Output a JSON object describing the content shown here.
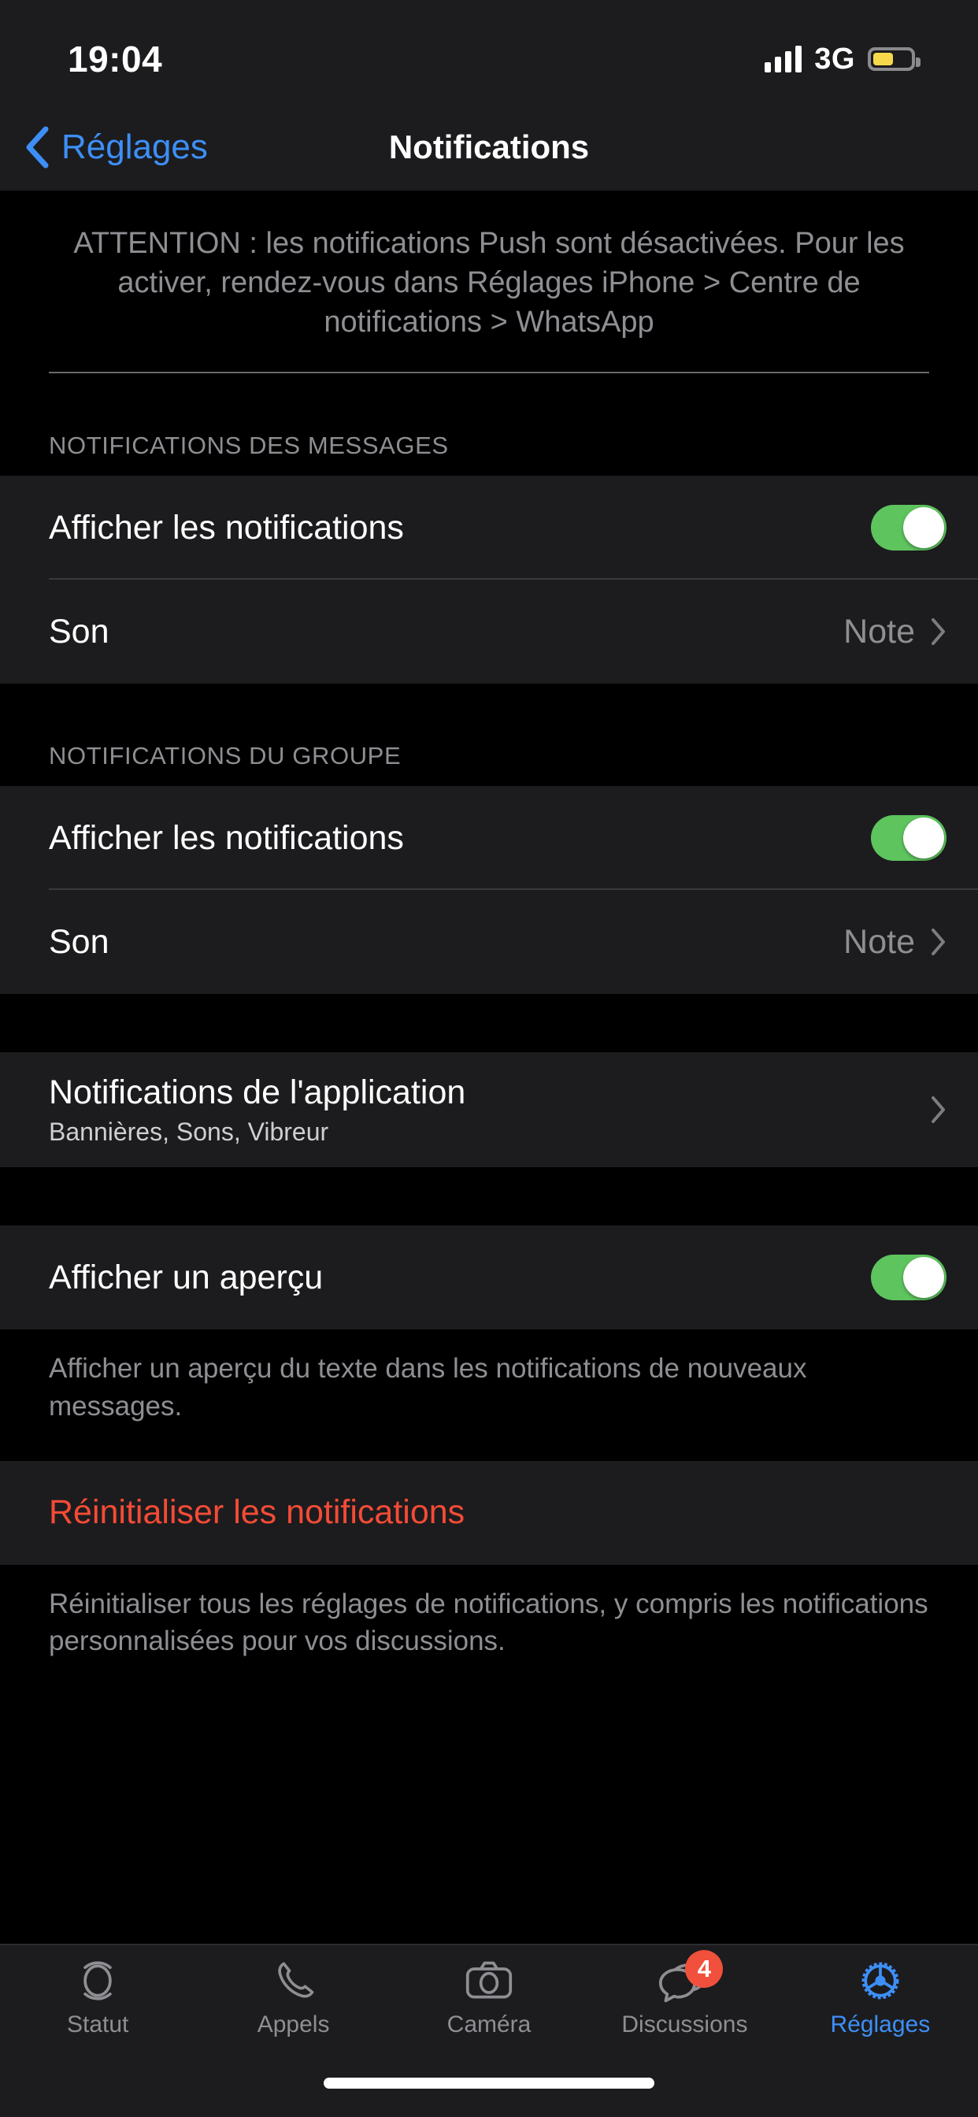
{
  "status_bar": {
    "time": "19:04",
    "network_type": "3G",
    "signal_icon": "cellular-signal-icon",
    "battery_icon": "battery-low-power-icon",
    "battery_color": "#f5d githubusercontent",
    "battery_fill_color": "#f7d84b",
    "battery_level_percent": 55
  },
  "nav_bar": {
    "back_icon": "chevron-left-icon",
    "back_label": "Réglages",
    "title": "Notifications",
    "accent_color": "#3d8ff7"
  },
  "warning": {
    "text": "ATTENTION : les notifications Push sont désactivées. Pour les activer, rendez-vous dans Réglages iPhone > Centre de notifications > WhatsApp"
  },
  "sections": {
    "messages": {
      "header": "NOTIFICATIONS DES MESSAGES",
      "show_notifications_label": "Afficher les notifications",
      "show_notifications_state": "on",
      "sound_label": "Son",
      "sound_value": "Note"
    },
    "group": {
      "header": "NOTIFICATIONS DU GROUPE",
      "show_notifications_label": "Afficher les notifications",
      "show_notifications_state": "on",
      "sound_label": "Son",
      "sound_value": "Note"
    },
    "app_notifications": {
      "title": "Notifications de l'application",
      "subtitle": "Bannières, Sons, Vibreur"
    },
    "preview": {
      "label": "Afficher un aperçu",
      "state": "on",
      "footnote": "Afficher un aperçu du texte dans les notifications de nouveaux messages."
    },
    "reset": {
      "label": "Réinitialiser les notifications",
      "color": "#f44b36",
      "footnote": "Réinitialiser tous les réglages de notifications, y compris les notifications personnalisées pour vos discussions."
    }
  },
  "toggle_on_color": "#5ec45e",
  "tab_bar": {
    "items": [
      {
        "label": "Statut",
        "icon": "status-rings-icon",
        "active": false,
        "badge": ""
      },
      {
        "label": "Appels",
        "icon": "phone-icon",
        "active": false,
        "badge": ""
      },
      {
        "label": "Caméra",
        "icon": "camera-icon",
        "active": false,
        "badge": ""
      },
      {
        "label": "Discussions",
        "icon": "chat-bubbles-icon",
        "active": false,
        "badge": "4"
      },
      {
        "label": "Réglages",
        "icon": "gear-icon",
        "active": true,
        "badge": ""
      }
    ]
  }
}
